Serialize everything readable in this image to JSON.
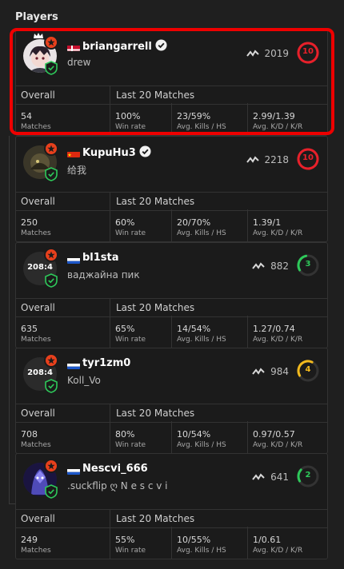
{
  "section_title": "Players",
  "players": [
    {
      "name": "briangarrell",
      "nickname": "drew",
      "flag": "dk",
      "verified": true,
      "avatar_text": "",
      "avatar_icon": "anime-avatar-with-crown-icon",
      "elo": "2019",
      "level": "10",
      "level_color": "#e8202a",
      "level_fill": 1.0,
      "highlighted": true,
      "overall_label": "Overall",
      "last20_label": "Last 20 Matches",
      "stats": [
        {
          "value": "54",
          "label": "Matches"
        },
        {
          "value": "100%",
          "label": "Win rate"
        },
        {
          "value": "23/59%",
          "label": "Avg. Kills / HS"
        },
        {
          "value": "2.99/1.39",
          "label": "Avg. K/D / K/R"
        }
      ]
    },
    {
      "name": "KupuHu3",
      "nickname": "给我",
      "flag": "cn",
      "verified": true,
      "avatar_text": "",
      "avatar_icon": "dark-creature-avatar-icon",
      "elo": "2218",
      "level": "10",
      "level_color": "#e8202a",
      "level_fill": 1.0,
      "highlighted": false,
      "overall_label": "Overall",
      "last20_label": "Last 20 Matches",
      "stats": [
        {
          "value": "250",
          "label": "Matches"
        },
        {
          "value": "60%",
          "label": "Win rate"
        },
        {
          "value": "20/70%",
          "label": "Avg. Kills / HS"
        },
        {
          "value": "1.39/1",
          "label": "Avg. K/D / K/R"
        }
      ]
    },
    {
      "name": "bl1sta",
      "nickname": "ваджайна пик",
      "flag": "ru",
      "verified": false,
      "avatar_text": "208:4",
      "avatar_icon": "",
      "elo": "882",
      "level": "3",
      "level_color": "#2ec95a",
      "level_fill": 0.3,
      "highlighted": false,
      "overall_label": "Overall",
      "last20_label": "Last 20 Matches",
      "stats": [
        {
          "value": "635",
          "label": "Matches"
        },
        {
          "value": "65%",
          "label": "Win rate"
        },
        {
          "value": "14/54%",
          "label": "Avg. Kills / HS"
        },
        {
          "value": "1.27/0.74",
          "label": "Avg. K/D / K/R"
        }
      ]
    },
    {
      "name": "tyr1zm0",
      "nickname": "Koll_Vo",
      "flag": "ru",
      "verified": false,
      "avatar_text": "208:4",
      "avatar_icon": "",
      "elo": "984",
      "level": "4",
      "level_color": "#f2b91d",
      "level_fill": 0.4,
      "highlighted": false,
      "overall_label": "Overall",
      "last20_label": "Last 20 Matches",
      "stats": [
        {
          "value": "708",
          "label": "Matches"
        },
        {
          "value": "80%",
          "label": "Win rate"
        },
        {
          "value": "10/54%",
          "label": "Avg. Kills / HS"
        },
        {
          "value": "0.97/0.57",
          "label": "Avg. K/D / K/R"
        }
      ]
    },
    {
      "name": "Nescvi_666",
      "nickname": ".suckflip ღ N e s c v i",
      "flag": "ru",
      "verified": false,
      "avatar_text": "",
      "avatar_icon": "blue-creature-avatar-icon",
      "elo": "641",
      "level": "2",
      "level_color": "#2ec95a",
      "level_fill": 0.2,
      "highlighted": false,
      "overall_label": "Overall",
      "last20_label": "Last 20 Matches",
      "stats": [
        {
          "value": "249",
          "label": "Matches"
        },
        {
          "value": "55%",
          "label": "Win rate"
        },
        {
          "value": "10/55%",
          "label": "Avg. Kills / HS"
        },
        {
          "value": "1/0.61",
          "label": "Avg. K/D / K/R"
        }
      ]
    }
  ]
}
